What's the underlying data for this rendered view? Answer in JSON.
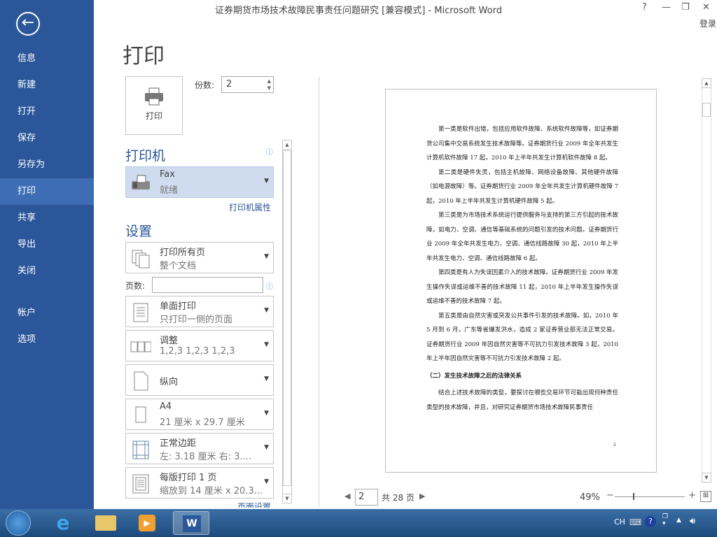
{
  "window": {
    "title": "证券期货市场技术故障民事责任问题研究 [兼容模式] - Microsoft Word",
    "help": "?",
    "minimize": "—",
    "restore": "❐",
    "close": "✕",
    "login": "登录"
  },
  "sidebar": {
    "back": "←",
    "items": [
      {
        "label": "信息"
      },
      {
        "label": "新建"
      },
      {
        "label": "打开"
      },
      {
        "label": "保存"
      },
      {
        "label": "另存为"
      },
      {
        "label": "打印"
      },
      {
        "label": "共享"
      },
      {
        "label": "导出"
      },
      {
        "label": "关闭"
      },
      {
        "label": "帐户"
      },
      {
        "label": "选项"
      }
    ]
  },
  "print": {
    "heading": "打印",
    "button": "打印",
    "copies_label": "份数:",
    "copies": "2",
    "printer_heading": "打印机",
    "printer_name": "Fax",
    "printer_status": "就绪",
    "printer_props": "打印机属性",
    "settings_heading": "设置",
    "pages_label": "页数:",
    "pages_value": "",
    "settings": [
      {
        "l1": "打印所有页",
        "l2": "整个文档"
      },
      {
        "l1": "单面打印",
        "l2": "只打印一侧的页面"
      },
      {
        "l1": "调整",
        "l2": "1,2,3    1,2,3    1,2,3"
      },
      {
        "l1": "纵向",
        "l2": ""
      },
      {
        "l1": "A4",
        "l2": "21 厘米 x 29.7 厘米"
      },
      {
        "l1": "正常边距",
        "l2": "左: 3.18 厘米    右: 3...."
      },
      {
        "l1": "每版打印 1 页",
        "l2": "缩放到 14 厘米 x 20.3..."
      }
    ],
    "page_setup": "页面设置"
  },
  "preview": {
    "paragraphs": [
      "第一类是软件出错，包括应用软件故障、系统软件故障等，如证券期货公司集中交易系统发生技术故障等。证券期货行业 2009 年全年共发生计算机软件故障 17 起，2010 年上半年共发生计算机软件故障 8 起。",
      "第二类是硬件失灵，包括主机故障、网络设备故障、其他硬件故障（如电源故障）等。证券期货行业 2009 年全年共发生计算机硬件故障 7 起，2010 年上半年共发生计算机硬件故障 5 起。",
      "第三类是为市场技术系统运行提供服务与支持的第三方引起的技术故障，如电力、空调、通信等基础系统的问题引发的技术问题。证券期货行业 2009 年全年共发生电力、空调、通信线路故障 30 起，2010 年上半年共发生电力、空调、通信线路故障 6 起。",
      "第四类是有人为失误因素介入的技术故障。证券期货行业 2009 年发生操作失误或运维不善的技术故障 11 起，2010 年上半年发生操作失误或运维不善的技术故障 7 起。",
      "第五类是由自然灾害或突发公共事件引发的技术故障。如，2010 年 5 月到 6 月，广东等省爆发洪水，造成 2 家证券营业部无法正常交易。证券期货行业 2009 年因自然灾害等不可抗力引发技术故障 3 起，2010 年上半年因自然灾害等不可抗力引发技术故障 2 起。"
    ],
    "section_heading": "（二）发生技术故障之后的法律关系",
    "last_paragraph": "结合上述技术故障的类型，要探讨在哪些交易环节可能出现何种责任类型的技术故障，并且，对研究证券期货市场技术故障民事责任",
    "page_number": "2",
    "current_page": "2",
    "total_pages": "共 28 页",
    "zoom": "49%"
  },
  "taskbar": {
    "lang": "CH"
  }
}
